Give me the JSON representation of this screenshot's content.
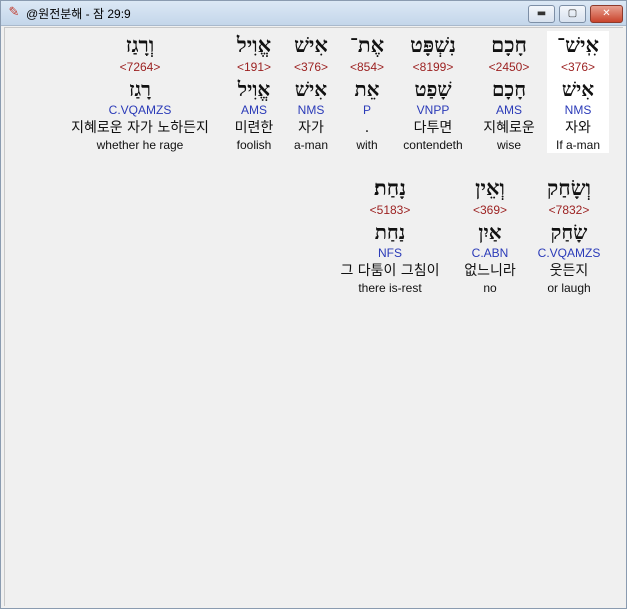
{
  "window": {
    "title": "@원전분해 - 잠 29:9",
    "app_icon": "app-logo-icon",
    "buttons": {
      "minimize": "▬",
      "maximize": "▢",
      "close": "✕"
    }
  },
  "rows": [
    {
      "words": [
        {
          "heb": "אִֽישׁ־",
          "strong": "<376>",
          "lemma": "אִישׁ",
          "morph": "NMS",
          "kor": "자와",
          "eng": "If a-man",
          "highlight": true
        },
        {
          "heb": "חָכָם",
          "strong": "<2450>",
          "lemma": "חָכָם",
          "morph": "AMS",
          "kor": "지혜로운",
          "eng": "wise"
        },
        {
          "heb": "נִשְׁפָּט",
          "strong": "<8199>",
          "lemma": "שָׁפַט",
          "morph": "VNPP",
          "kor": "다투면",
          "eng": "contendeth"
        },
        {
          "heb": "אֶת־",
          "strong": "<854>",
          "lemma": "אֵת",
          "morph": "P",
          "kor": ".",
          "eng": "with"
        },
        {
          "heb": "אִישׁ",
          "strong": "<376>",
          "lemma": "אִישׁ",
          "morph": "NMS",
          "kor": "자가",
          "eng": "a-man"
        },
        {
          "heb": "אֱוִיל",
          "strong": "<191>",
          "lemma": "אֱוִיל",
          "morph": "AMS",
          "kor": "미련한",
          "eng": "foolish"
        },
        {
          "heb": "וְרָגַז",
          "strong": "<7264>",
          "lemma": "רָגַז",
          "morph": "C.VQAMZS",
          "kor": "지혜로운 자가 노하든지",
          "eng": "whether he rage"
        }
      ]
    },
    {
      "words": [
        {
          "heb": "וְשָׂחַק",
          "strong": "<7832>",
          "lemma": "שָׂחַק",
          "morph": "C.VQAMZS",
          "kor": "웃든지",
          "eng": "or laugh"
        },
        {
          "heb": "וְאֵין",
          "strong": "<369>",
          "lemma": "אַיִן",
          "morph": "C.ABN",
          "kor": "없느니라",
          "eng": "no"
        },
        {
          "heb": "נָחַת׃",
          "strong": "<5183>",
          "lemma": "נַחַת",
          "morph": "NFS",
          "kor": "그 다툼이 그침이",
          "eng": "there is-rest"
        }
      ]
    }
  ]
}
